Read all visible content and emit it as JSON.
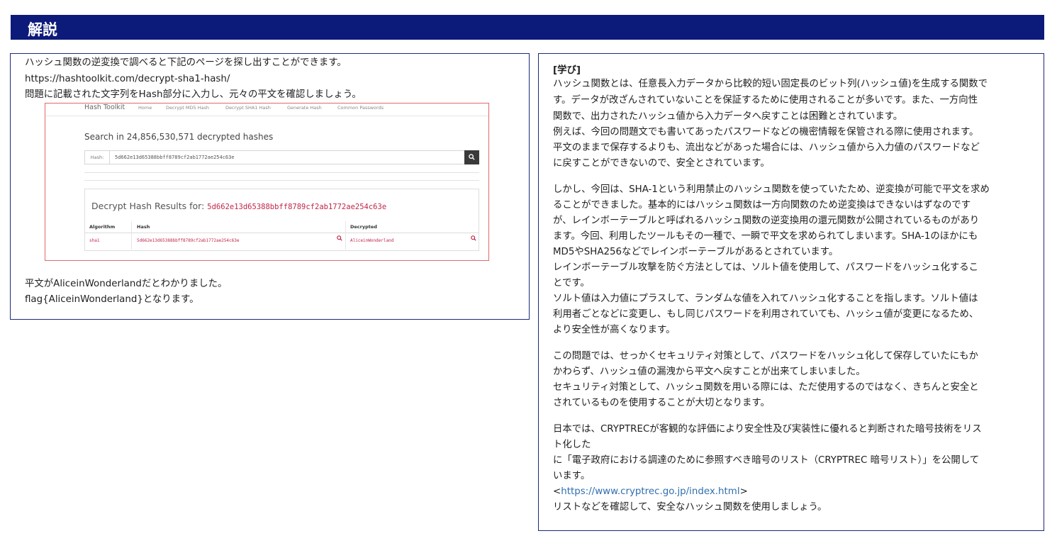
{
  "header": {
    "title": "解説"
  },
  "left": {
    "lines": [
      "ハッシュ関数の逆変換で調べると下記のページを探し出すことができます。",
      "https://hashtoolkit.com/decrypt-sha1-hash/",
      "問題に記載された文字列をHash部分に入力し、元々の平文を確認しましょう。"
    ],
    "screenshot": {
      "brand": "Hash Toolkit",
      "nav": [
        "Home",
        "Decrypt MD5 Hash",
        "Decrypt SHA1 Hash",
        "Generate Hash",
        "Common Passwords"
      ],
      "search_title": "Search in 24,856,530,571 decrypted hashes",
      "hash_label": "Hash:",
      "hash_value": "5d662e13d65388bbff8789cf2ab1772ae254c63e",
      "search_icon": "search-icon",
      "results_title": "Decrypt Hash Results for:",
      "results_hash": "5d662e13d65388bbff8789cf2ab1772ae254c63e",
      "columns": [
        "Algorithm",
        "Hash",
        "Decrypted"
      ],
      "row": {
        "algorithm": "sha1",
        "hash": "5d662e13d65388bbff8789cf2ab1772ae254c63e",
        "decrypted": "AliceinWonderland"
      }
    },
    "after": [
      "平文がAliceinWonderlandだとわかりました。",
      "flag{AliceinWonderland}となります。"
    ]
  },
  "right": {
    "heading": "[学び]",
    "p1": [
      "ハッシュ関数とは、任意長入力データから比較的短い固定長のビット列(ハッシュ値)を生成する関数で",
      "す。データが改ざんされていないことを保証するために使用されることが多いです。また、一方向性",
      "関数で、出力されたハッシュ値から入力データへ戻すことは困難とされています。",
      "例えば、今回の問題文でも書いてあったパスワードなどの機密情報を保管される際に使用されます。",
      "平文のままで保存するよりも、流出などがあった場合には、ハッシュ値から入力値のパスワードなど",
      "に戻すことができないので、安全とされています。"
    ],
    "p2": [
      "しかし、今回は、SHA-1という利用禁止のハッシュ関数を使っていたため、逆変換が可能で平文を求め",
      "ることができました。基本的にはハッシュ関数は一方向関数のため逆変換はできないはずなのです",
      "が、レインボーテーブルと呼ばれるハッシュ関数の逆変換用の還元関数が公開されているものがあり",
      "ます。今回、利用したツールもその一種で、一瞬で平文を求められてしまいます。SHA-1のほかにも",
      "MD5やSHA256などでレインボーテーブルがあるとされています。",
      "レインボーテーブル攻撃を防ぐ方法としては、ソルト値を使用して、パスワードをハッシュ化するこ",
      "とです。",
      "ソルト値は入力値にプラスして、ランダムな値を入れてハッシュ化することを指します。ソルト値は",
      "利用者ごとなどに変更し、もし同じパスワードを利用されていても、ハッシュ値が変更になるため、",
      "より安全性が高くなります。"
    ],
    "p3": [
      "この問題では、せっかくセキュリティ対策として、パスワードをハッシュ化して保存していたにもか",
      "かわらず、ハッシュ値の漏洩から平文へ戻すことが出来てしまいました。",
      "セキュリティ対策として、ハッシュ関数を用いる際には、ただ使用するのではなく、きちんと安全と",
      "されているものを使用することが大切となります。"
    ],
    "p4": [
      "日本では、CRYPTRECが客観的な評価により安全性及び実装性に優れると判断された暗号技術をリス",
      "ト化した",
      "に「電子政府における調達のために参照すべき暗号のリスト（CRYPTREC 暗号リスト）」を公開して",
      "います。"
    ],
    "link_open": "<",
    "link": "https://www.cryptrec.go.jp/index.html",
    "link_close": ">",
    "last": "リストなどを確認して、安全なハッシュ関数を使用しましょう。"
  }
}
